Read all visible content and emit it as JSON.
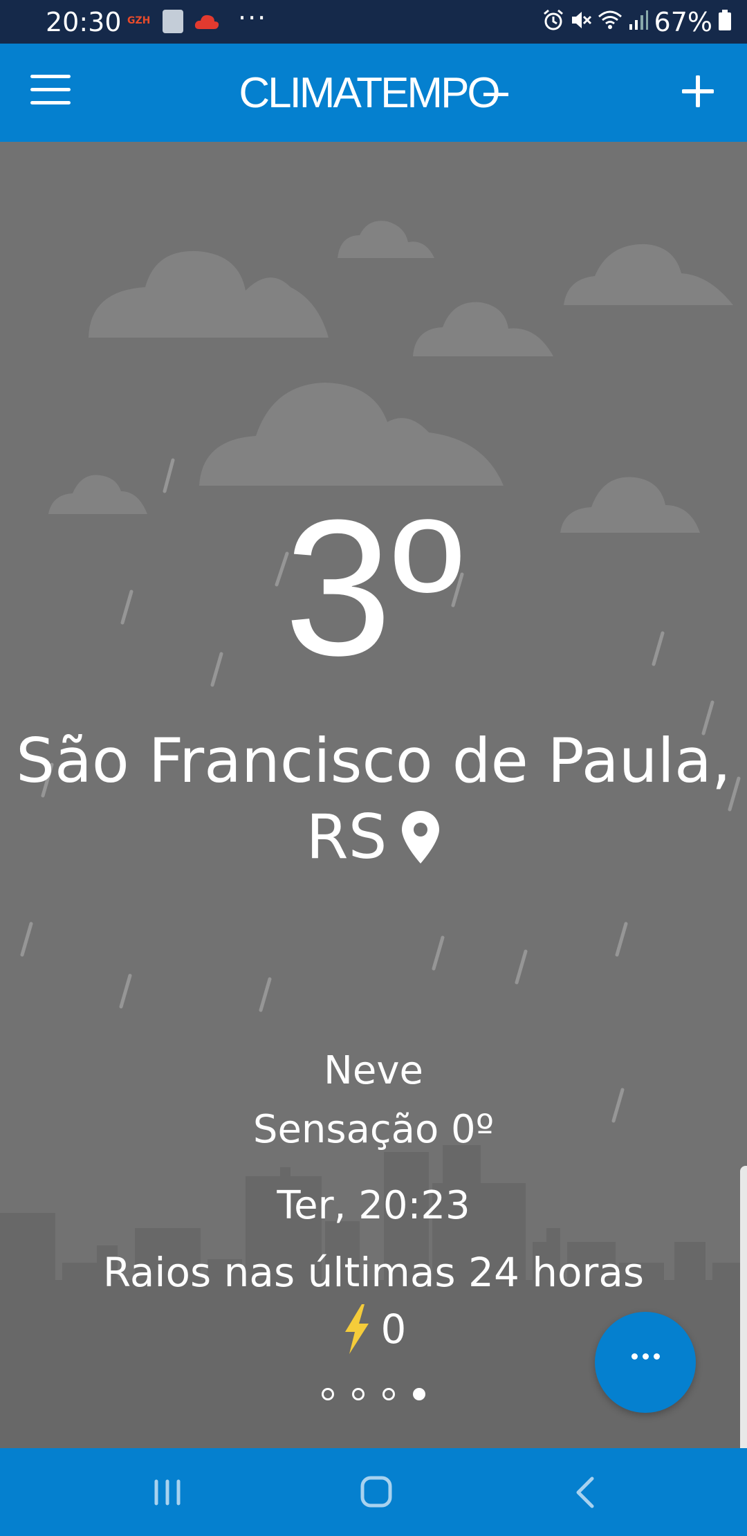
{
  "status_bar": {
    "time": "20:30",
    "gzh_label": "GZH",
    "more_notifications": "···",
    "battery": "67%",
    "icons": [
      "alarm-icon",
      "mute-icon",
      "wifi-icon",
      "signal-icon",
      "battery-icon"
    ]
  },
  "app_bar": {
    "brand": "CLIMATEMPO",
    "menu_icon": "hamburger-menu-icon",
    "add_icon": "plus-icon"
  },
  "weather": {
    "temperature": "3º",
    "city_line1": "São Francisco de Paula,",
    "city_line2": "RS",
    "condition": "Neve",
    "feels_like": "Sensação 0º",
    "datetime": "Ter, 20:23",
    "lightning_title": "Raios nas últimas 24 horas",
    "lightning_count": "0"
  },
  "pager": {
    "total": 4,
    "active_index": 3
  },
  "colors": {
    "primary": "#0580cf",
    "status_bar": "#15294a",
    "scene_bg": "#727272",
    "bolt": "#f5cc3a"
  },
  "nav_bar": {
    "buttons": [
      "recent-apps-icon",
      "home-icon",
      "back-icon"
    ]
  }
}
